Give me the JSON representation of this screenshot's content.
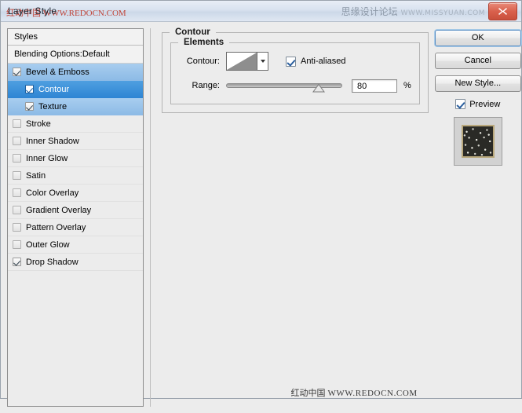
{
  "window": {
    "title": "Layer Style",
    "watermark_title": "红动中国 WWW.REDOCN.COM",
    "watermark_right_cn": "思缘设计论坛",
    "watermark_right_en": "WWW.MISSYUAN.COM",
    "close_icon": "close-icon",
    "close_color": "#d9604c"
  },
  "styles_panel": {
    "header": "Styles",
    "blending_options": "Blending Options:Default",
    "items": [
      {
        "label": "Bevel & Emboss",
        "checked": true,
        "selected": "light",
        "sub": false
      },
      {
        "label": "Contour",
        "checked": true,
        "selected": "strong",
        "sub": true
      },
      {
        "label": "Texture",
        "checked": true,
        "selected": "light",
        "sub": true
      },
      {
        "label": "Stroke",
        "checked": false,
        "selected": "none",
        "sub": false
      },
      {
        "label": "Inner Shadow",
        "checked": false,
        "selected": "none",
        "sub": false
      },
      {
        "label": "Inner Glow",
        "checked": false,
        "selected": "none",
        "sub": false
      },
      {
        "label": "Satin",
        "checked": false,
        "selected": "none",
        "sub": false
      },
      {
        "label": "Color Overlay",
        "checked": false,
        "selected": "none",
        "sub": false
      },
      {
        "label": "Gradient Overlay",
        "checked": false,
        "selected": "none",
        "sub": false
      },
      {
        "label": "Pattern Overlay",
        "checked": false,
        "selected": "none",
        "sub": false
      },
      {
        "label": "Outer Glow",
        "checked": false,
        "selected": "none",
        "sub": false
      },
      {
        "label": "Drop Shadow",
        "checked": true,
        "selected": "none",
        "sub": false
      }
    ],
    "selection_color_light": "#8dbbe6",
    "selection_color_strong": "#2f86d4"
  },
  "contour_panel": {
    "title": "Contour",
    "elements_title": "Elements",
    "contour_label": "Contour:",
    "contour_swatch_icon": "linear-contour-icon",
    "dropdown_icon": "chevron-down-icon",
    "anti_aliased_label": "Anti-aliased",
    "anti_aliased_checked": true,
    "range_label": "Range:",
    "range_value": "80",
    "range_percent_symbol": "%",
    "range_slider_position": 80
  },
  "buttons": {
    "ok": "OK",
    "cancel": "Cancel",
    "new_style": "New Style...",
    "preview_label": "Preview",
    "preview_checked": true
  },
  "footer": {
    "watermark_cn": "红动中国",
    "watermark_en": "WWW.REDOCN.COM"
  }
}
